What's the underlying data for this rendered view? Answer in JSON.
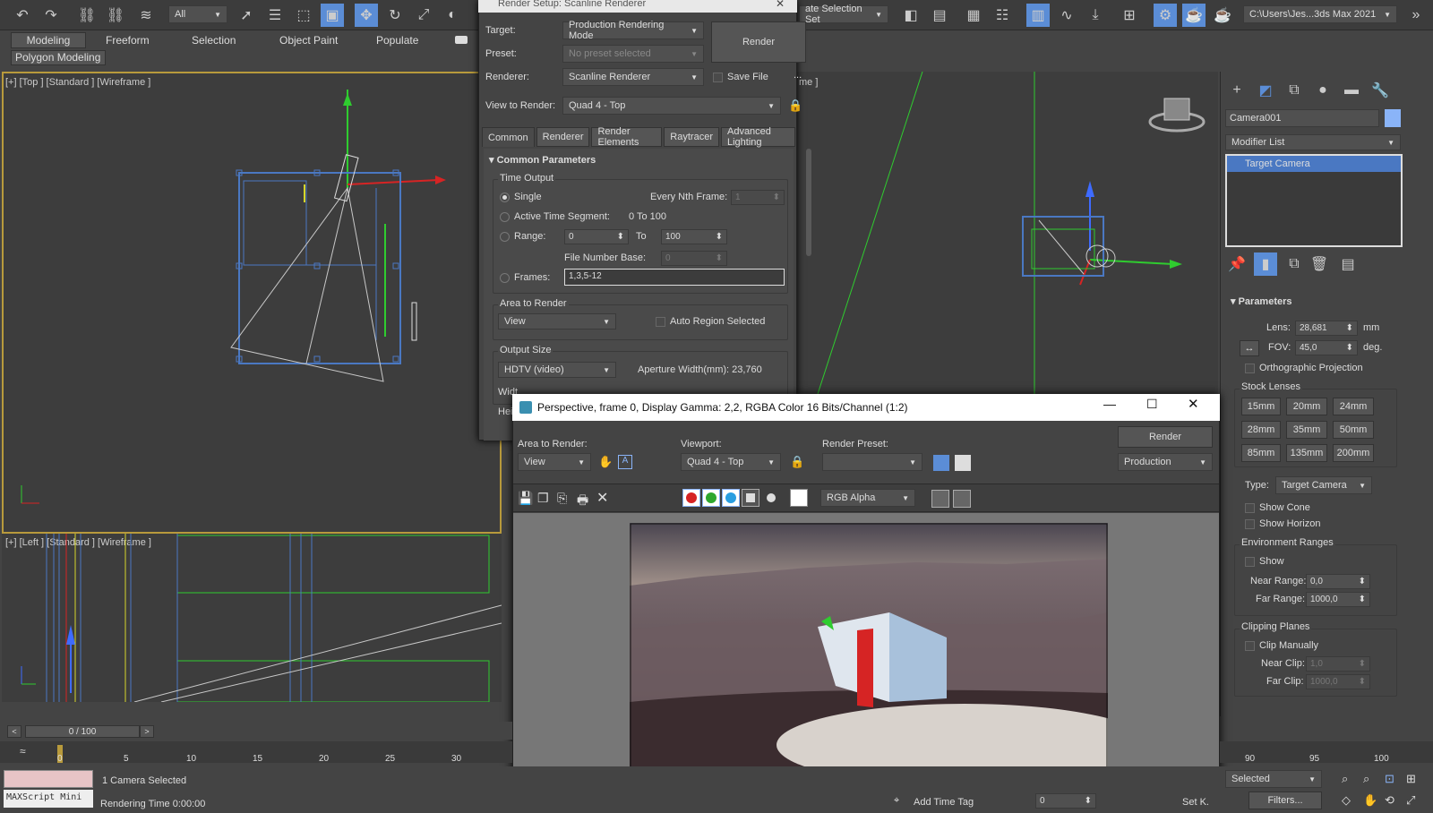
{
  "toolbar": {
    "filter_value": "All",
    "selection_set_value": "ate Selection Set",
    "path": "C:\\Users\\Jes...3ds Max 2021"
  },
  "ribbon": {
    "tabs": [
      "Modeling",
      "Freeform",
      "Selection",
      "Object Paint",
      "Populate"
    ],
    "sub": "Polygon Modeling"
  },
  "viewports": {
    "top": "[+] [Top ] [Standard ] [Wireframe ]",
    "left": "[+] [Left ] [Standard ] [Wireframe ]",
    "persp_tail": "me ]"
  },
  "render_setup": {
    "title": "Render Setup: Scanline Renderer",
    "target_label": "Target:",
    "target": "Production Rendering Mode",
    "preset_label": "Preset:",
    "preset": "No preset selected",
    "renderer_label": "Renderer:",
    "renderer": "Scanline Renderer",
    "save_file": "Save File",
    "more": "...",
    "view_label": "View to Render:",
    "view": "Quad 4 - Top",
    "render_btn": "Render",
    "tabs": [
      "Common",
      "Renderer",
      "Render Elements",
      "Raytracer",
      "Advanced Lighting"
    ],
    "rollout": "Common Parameters",
    "time_output": "Time Output",
    "single": "Single",
    "nth_label": "Every Nth Frame:",
    "nth": "1",
    "active": "Active Time Segment:",
    "active_val": "0 To 100",
    "range": "Range:",
    "range_from": "0",
    "to": "To",
    "range_to": "100",
    "fnb_label": "File Number Base:",
    "fnb": "0",
    "frames": "Frames:",
    "frames_val": "1,3,5-12",
    "area_title": "Area to Render",
    "area": "View",
    "auto_region": "Auto Region Selected",
    "output_title": "Output Size",
    "output": "HDTV (video)",
    "aperture": "Aperture Width(mm): 23,760",
    "width_label": "Widt",
    "height_label": "Hei"
  },
  "frame_window": {
    "title": "Perspective, frame 0, Display Gamma: 2,2, RGBA Color 16 Bits/Channel (1:2)",
    "area_label": "Area to Render:",
    "area": "View",
    "viewport_label": "Viewport:",
    "viewport": "Quad 4 - Top",
    "preset_label": "Render Preset:",
    "preset": "",
    "render": "Render",
    "mode": "Production",
    "channel": "RGB Alpha"
  },
  "command_panel": {
    "object_name": "Camera001",
    "modifier_list": "Modifier List",
    "stack_item": "Target Camera",
    "params": "Parameters",
    "lens_label": "Lens:",
    "lens": "28,681",
    "lens_unit": "mm",
    "fov_label": "FOV:",
    "fov": "45,0",
    "fov_unit": "deg.",
    "ortho": "Orthographic Projection",
    "stock": "Stock Lenses",
    "lenses": [
      "15mm",
      "20mm",
      "24mm",
      "28mm",
      "35mm",
      "50mm",
      "85mm",
      "135mm",
      "200mm"
    ],
    "type_label": "Type:",
    "type": "Target Camera",
    "show_cone": "Show Cone",
    "show_horizon": "Show Horizon",
    "env": "Environment Ranges",
    "show": "Show",
    "near_label": "Near Range:",
    "near": "0,0",
    "far_label": "Far Range:",
    "far": "1000,0",
    "clip": "Clipping Planes",
    "clip_manual": "Clip Manually",
    "near_clip_label": "Near Clip:",
    "near_clip": "1,0",
    "far_clip_label": "Far Clip:",
    "far_clip": "1000,0"
  },
  "timeline": {
    "frame": "0 / 100",
    "ticks": [
      "0",
      "5",
      "10",
      "15",
      "20",
      "25",
      "30"
    ],
    "ticks_right": [
      "90",
      "95",
      "100"
    ]
  },
  "status": {
    "maxscript": "MAXScript Mini",
    "selected": "1 Camera Selected",
    "render_time": "Rendering Time  0:00:00",
    "add_time_tag": "Add Time Tag",
    "set_key": "Set K.",
    "filters": "Filters...",
    "selected_dd": "Selected",
    "key_val": "0"
  },
  "colors": {
    "accent": "#5b8dd6",
    "selection": "#4a78c2",
    "green": "#2fcc2f",
    "red": "#d62424"
  }
}
